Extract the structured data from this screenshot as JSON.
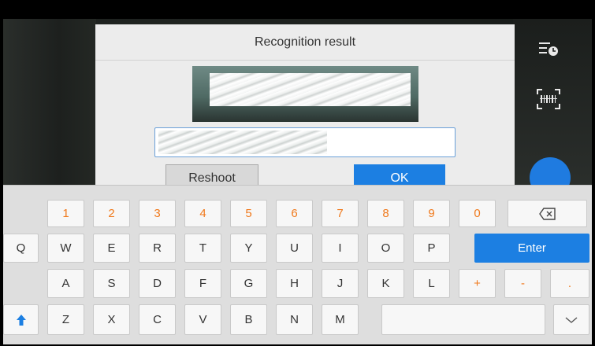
{
  "dialog": {
    "title": "Recognition result",
    "reshoot_label": "Reshoot",
    "ok_label": "OK"
  },
  "keyboard": {
    "row1": [
      "1",
      "2",
      "3",
      "4",
      "5",
      "6",
      "7",
      "8",
      "9",
      "0"
    ],
    "row2": [
      "Q",
      "W",
      "E",
      "R",
      "T",
      "Y",
      "U",
      "I",
      "O",
      "P"
    ],
    "enter_label": "Enter",
    "row3": [
      "A",
      "S",
      "D",
      "F",
      "G",
      "H",
      "J",
      "K",
      "L"
    ],
    "row3_symbols": [
      "+",
      "-",
      "."
    ],
    "row4": [
      "Z",
      "X",
      "C",
      "V",
      "B",
      "N",
      "M"
    ]
  },
  "icons": {
    "history": "history-clock-icon",
    "barcode": "barcode-scan-icon",
    "text_recognize": "text-recognize-icon",
    "backspace": "backspace-icon",
    "shift": "shift-arrow-icon",
    "collapse": "chevron-down-icon"
  },
  "colors": {
    "accent": "#1c7fe2",
    "number_keys": "#f07a1d"
  }
}
